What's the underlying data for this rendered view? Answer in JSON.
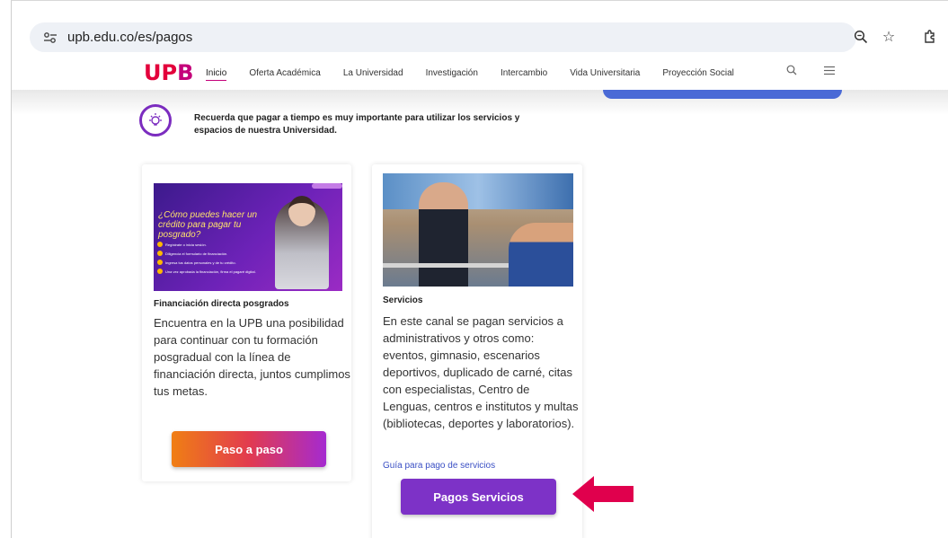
{
  "browser": {
    "url": "upb.edu.co/es/pagos",
    "icons": [
      "tune-icon",
      "zoom-icon",
      "star-icon",
      "extensions-icon"
    ]
  },
  "header": {
    "logo": "UPB",
    "nav": [
      "Inicio",
      "Oferta Académica",
      "La Universidad",
      "Investigación",
      "Intercambio",
      "Vida Universitaria",
      "Proyección Social"
    ],
    "active_nav": "Inicio"
  },
  "reminder": {
    "text": "Recuerda que pagar a tiempo es muy importante para utilizar los servicios y espacios de nuestra Universidad."
  },
  "card_financiacion": {
    "image_title": "¿Cómo puedes hacer un crédito para pagar tu posgrado?",
    "image_steps": [
      "Regístrate o inicia sesión.",
      "Diligencia el formulario de financiación.",
      "Ingresa tus datos personales y de tu crédito.",
      "Una vez aprobada la financiación, firma el pagaré digital."
    ],
    "caption": "Financiación directa posgrados",
    "description": "Encuentra en la UPB una posibilidad para continuar con tu formación posgradual con la línea de financiación directa, juntos cumplimos tus metas.",
    "button_label": "Paso a paso"
  },
  "card_servicios": {
    "caption": "Servicios",
    "description": "En este canal se pagan servicios a administrativos y otros como: eventos, gimnasio, escenarios deportivos, duplicado de carné, citas con especialistas, Centro de Lenguas, centros e institutos y multas (bibliotecas, deportes y laboratorios).",
    "link": "Guía para pago de servicios",
    "button_label": "Pagos Servicios"
  },
  "colors": {
    "accent_purple": "#7d32c7",
    "arrow": "#e0004d",
    "brand_red": "#e3003b",
    "brand_magenta": "#c4007a"
  }
}
